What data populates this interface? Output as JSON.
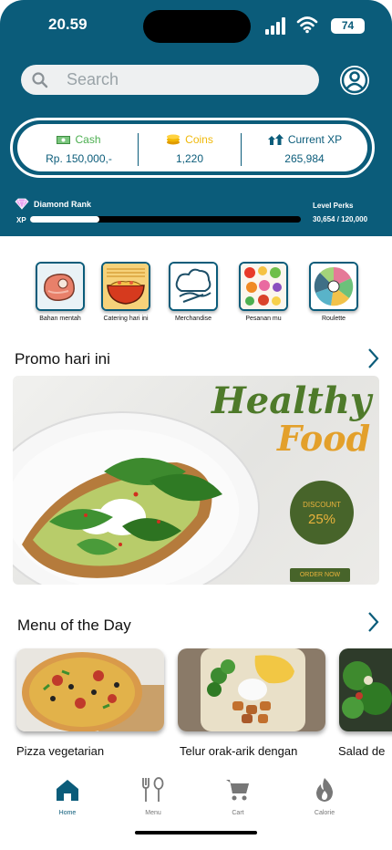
{
  "status": {
    "time": "20.59",
    "battery": "74"
  },
  "search": {
    "placeholder": "Search"
  },
  "stats": {
    "cash": {
      "label": "Cash",
      "value": "Rp. 150,000,-"
    },
    "coins": {
      "label": "Coins",
      "value": "1,220"
    },
    "xp": {
      "label": "Current XP",
      "value": "265,984"
    }
  },
  "rank": {
    "title": "Diamond Rank",
    "xp_label": "XP",
    "perks_label": "Level Perks",
    "progress_text": "30,654 / 120,000",
    "progress_fraction": 0.255
  },
  "categories": [
    {
      "label": "Bahan mentah",
      "icon": "meat-icon"
    },
    {
      "label": "Catering hari ini",
      "icon": "noodle-bowl-icon"
    },
    {
      "label": "Merchandise",
      "icon": "chef-hat-icon"
    },
    {
      "label": "Pesanan mu",
      "icon": "food-order-icon"
    },
    {
      "label": "Roulette",
      "icon": "roulette-icon"
    }
  ],
  "promo": {
    "title": "Promo hari ini",
    "banner": {
      "line1": "Healthy",
      "line2": "Food",
      "discount_label": "DISCOUNT",
      "discount_value": "25%",
      "cta": "ORDER NOW"
    }
  },
  "menu": {
    "title": "Menu of the Day",
    "items": [
      {
        "name": "Pizza vegetarian"
      },
      {
        "name": "Telur orak-arik dengan"
      },
      {
        "name": "Salad de"
      }
    ]
  },
  "nav": [
    {
      "label": "Home",
      "icon": "home-icon",
      "active": true
    },
    {
      "label": "Menu",
      "icon": "fork-spoon-icon"
    },
    {
      "label": "Cart",
      "icon": "cart-icon"
    },
    {
      "label": "Calorie",
      "icon": "flame-icon"
    }
  ],
  "colors": {
    "primary": "#0b5c7a",
    "promo_green": "#47642a",
    "promo_orange": "#e3a02b",
    "cash": "#4caf50",
    "coins": "#f0b90b"
  }
}
